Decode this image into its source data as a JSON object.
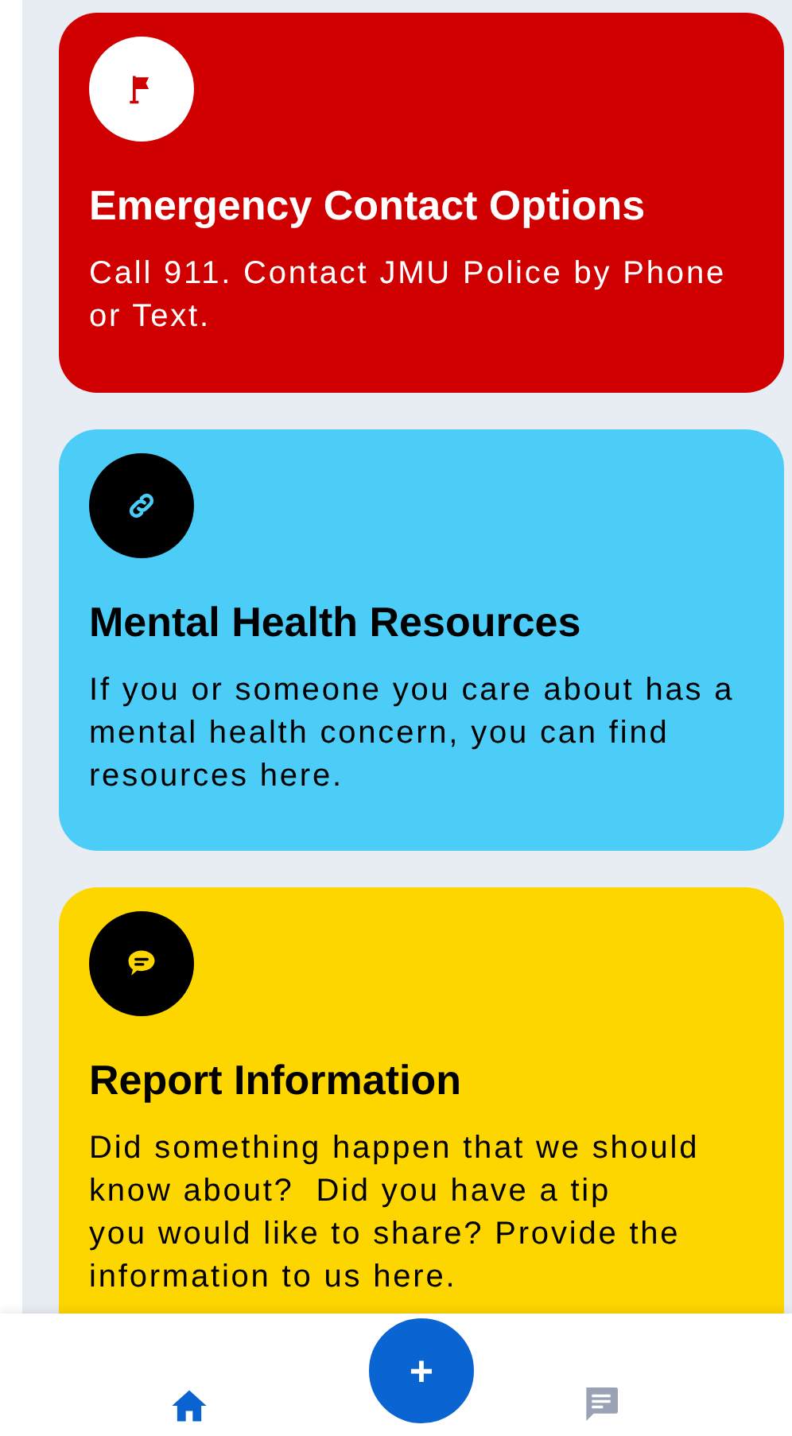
{
  "cards": [
    {
      "kind": "emergency",
      "title": "Emergency Contact Options",
      "body": "Call 911. Contact JMU Police by Phone or Text."
    },
    {
      "kind": "mental_health",
      "title": "Mental Health Resources",
      "body": "If you or someone you care about has a mental health concern, you can find resources here."
    },
    {
      "kind": "report",
      "title": "Report Information",
      "body": "Did something happen that we should know about?  Did you have a tip\nyou would like to share? Provide the information to us here."
    }
  ],
  "bottom_nav": {
    "items": [
      {
        "kind": "home",
        "selected": true
      },
      {
        "kind": "messages",
        "selected": false
      }
    ],
    "fab": "+"
  }
}
